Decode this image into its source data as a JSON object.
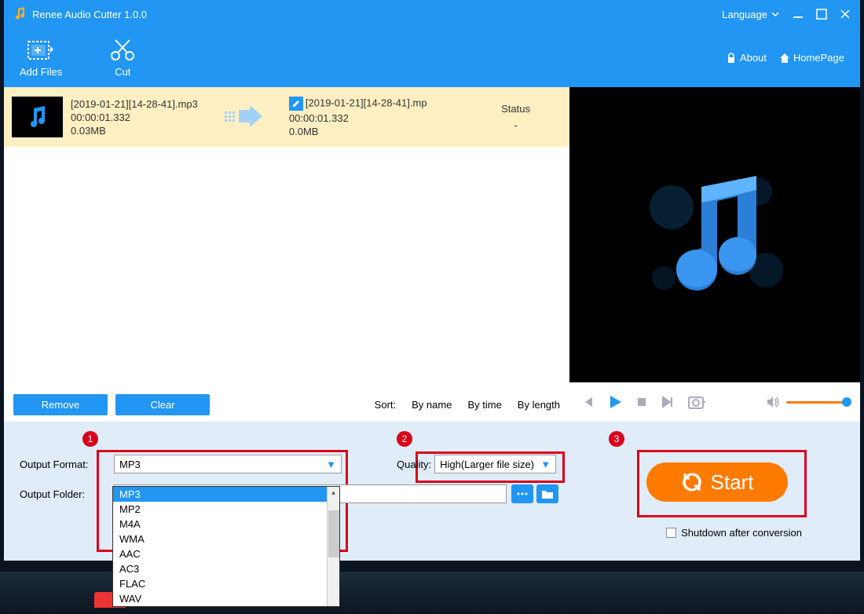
{
  "titlebar": {
    "title": "Renee Audio Cutter 1.0.0",
    "language": "Language"
  },
  "toolbar": {
    "addFiles": "Add Files",
    "cut": "Cut",
    "about": "About",
    "homepage": "HomePage"
  },
  "file": {
    "srcName": "[2019-01-21][14-28-41].mp3",
    "srcDuration": "00:00:01.332",
    "srcSize": "0.03MB",
    "dstName": "[2019-01-21][14-28-41].mp",
    "dstDuration": "00:00:01.332",
    "dstSize": "0.0MB",
    "statusLabel": "Status",
    "statusValue": "-"
  },
  "buttons": {
    "remove": "Remove",
    "clear": "Clear"
  },
  "sort": {
    "label": "Sort:",
    "byName": "By name",
    "byTime": "By time",
    "byLength": "By length"
  },
  "form": {
    "outputFormat": "Output Format:",
    "outputFolder": "Output Folder:",
    "quality": "Quality:",
    "formatValue": "MP3",
    "qualityValue": "High(Larger file size)"
  },
  "formats": [
    "MP3",
    "MP2",
    "M4A",
    "WMA",
    "AAC",
    "AC3",
    "FLAC",
    "WAV"
  ],
  "start": "Start",
  "shutdown": "Shutdown after conversion",
  "badges": {
    "one": "1",
    "two": "2",
    "three": "3"
  }
}
